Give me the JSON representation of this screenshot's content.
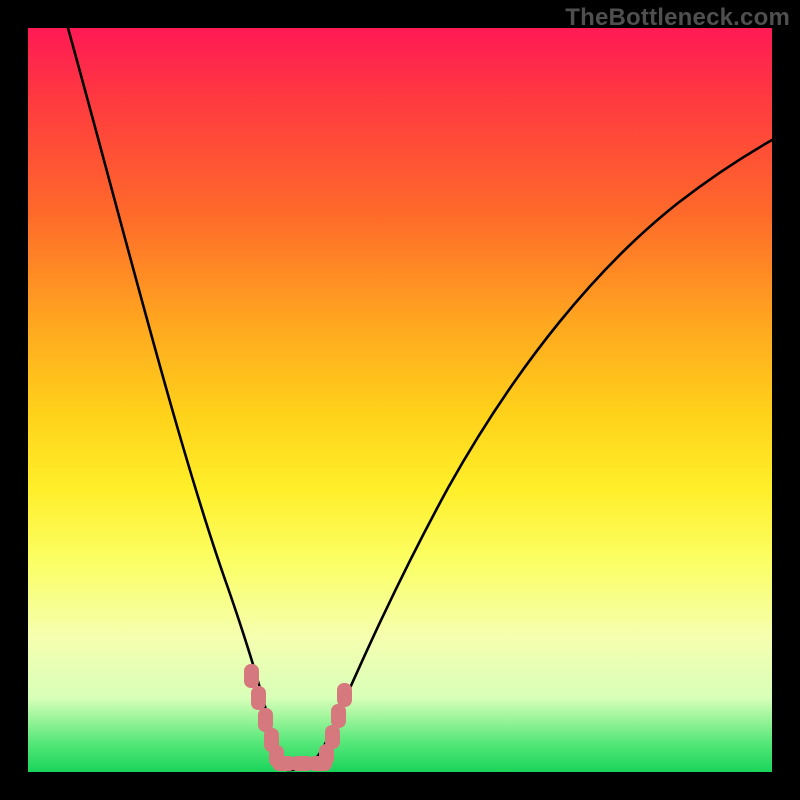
{
  "watermark": {
    "text": "TheBottleneck.com"
  },
  "chart_data": {
    "type": "line",
    "title": "",
    "xlabel": "",
    "ylabel": "",
    "xlim": [
      0,
      100
    ],
    "ylim": [
      0,
      100
    ],
    "grid": false,
    "legend": false,
    "series": [
      {
        "name": "bottleneck-curve",
        "color": "#000000",
        "x": [
          5,
          10,
          15,
          20,
          25,
          28,
          30,
          32,
          34,
          36,
          38,
          40,
          45,
          50,
          55,
          60,
          65,
          70,
          75,
          80,
          85,
          90,
          95,
          100
        ],
        "values": [
          100,
          82,
          64,
          46,
          28,
          15,
          7,
          2,
          0,
          0,
          1,
          4,
          12,
          22,
          32,
          41,
          49,
          56,
          62,
          67,
          71,
          74,
          77,
          79
        ]
      }
    ],
    "highlight": {
      "name": "optimal-range",
      "color": "#d6797e",
      "points_x": [
        28.5,
        29.5,
        30.5,
        31.0,
        31.7,
        33.0,
        34.5,
        36.0,
        37.2,
        38.0,
        38.8,
        39.5
      ],
      "points_y": [
        13.0,
        9.0,
        5.0,
        2.3,
        0.8,
        0.3,
        0.3,
        0.3,
        0.8,
        2.5,
        5.5,
        9.0
      ]
    },
    "background_gradient": {
      "top_color": "#ff1a55",
      "bottom_color": "#19d45a",
      "meaning": "red=high bottleneck, green=optimal"
    }
  }
}
